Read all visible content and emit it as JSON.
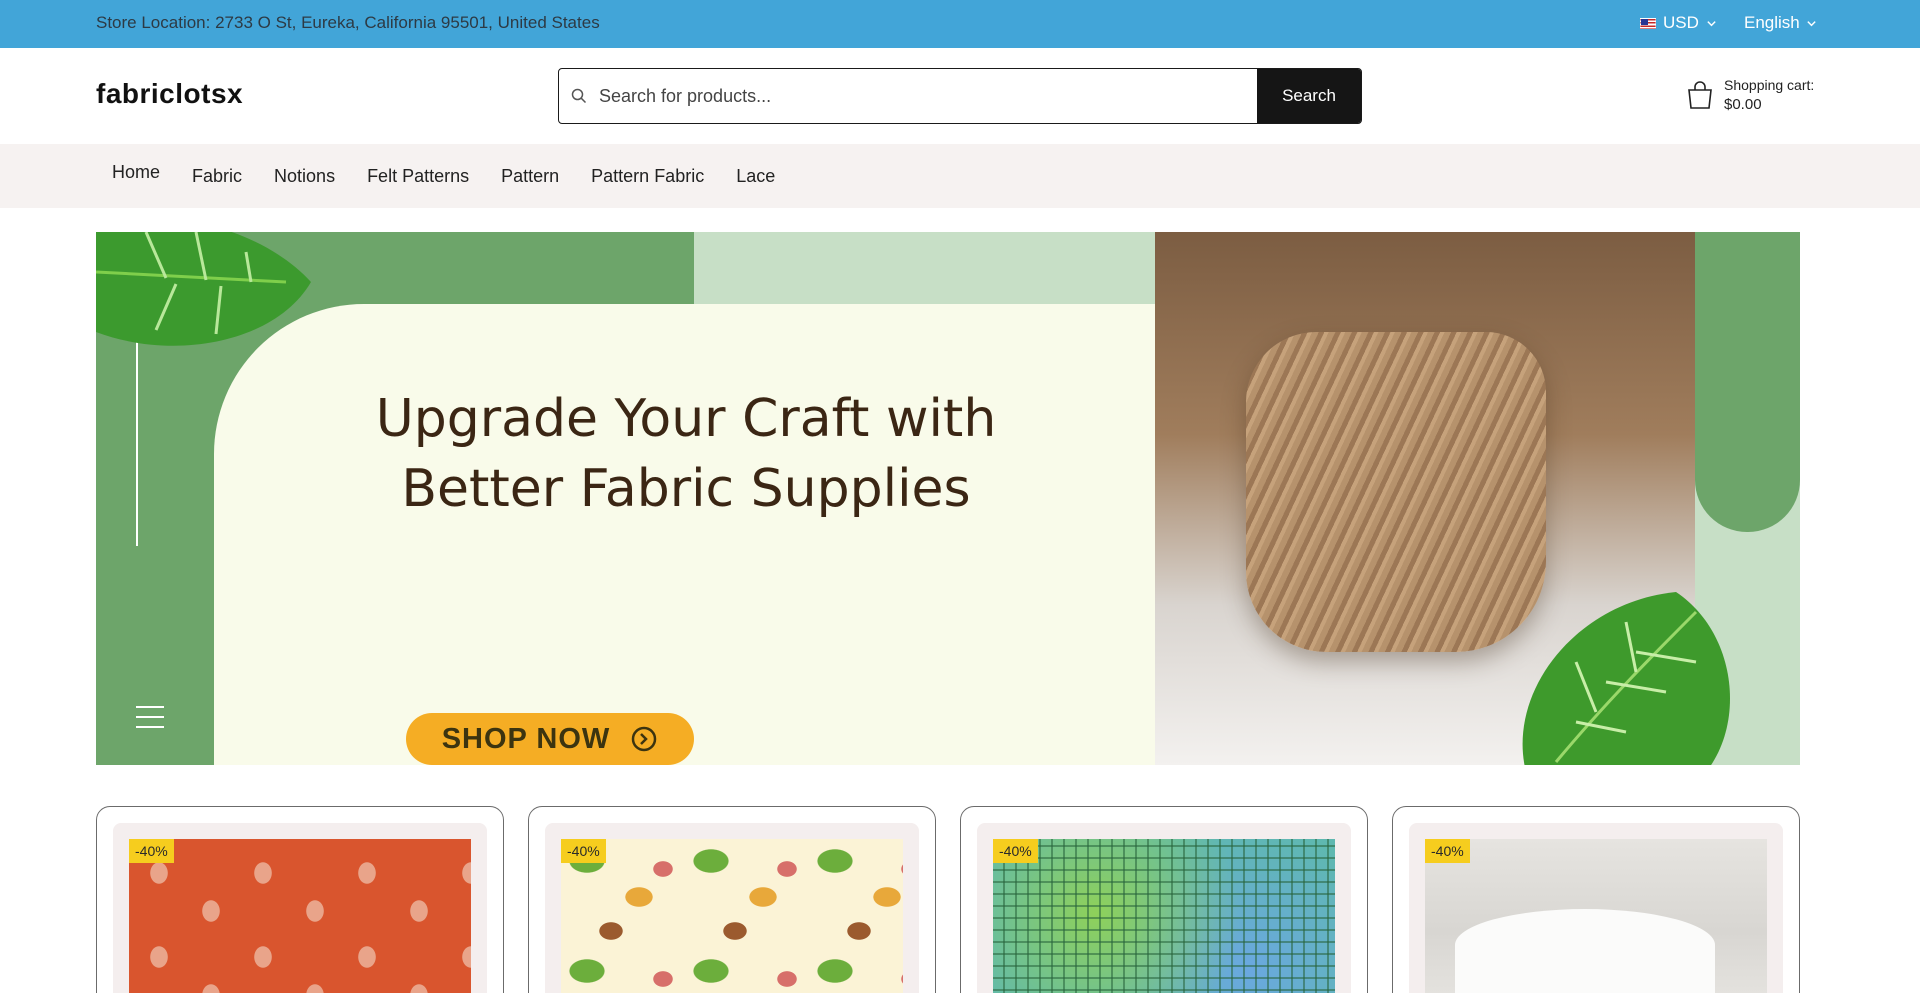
{
  "topbar": {
    "location": "Store Location: 2733 O St, Eureka, California 95501, United States",
    "currency": "USD",
    "language": "English"
  },
  "header": {
    "logo": "fabriclotsx",
    "search_placeholder": "Search for products...",
    "search_button": "Search",
    "cart_label": "Shopping cart:",
    "cart_amount": "$0.00"
  },
  "nav": {
    "items": [
      {
        "label": "Home"
      },
      {
        "label": "Fabric"
      },
      {
        "label": "Notions"
      },
      {
        "label": "Felt Patterns"
      },
      {
        "label": "Pattern"
      },
      {
        "label": "Pattern Fabric"
      },
      {
        "label": "Lace"
      }
    ]
  },
  "banner": {
    "headline_line1": "Upgrade Your Craft with",
    "headline_line2": "Better Fabric Supplies",
    "cta": "SHOP NOW"
  },
  "products": [
    {
      "badge": "-40%",
      "image": "turtle-print-fabric"
    },
    {
      "badge": "-40%",
      "image": "butterfly-insect-print-fabric"
    },
    {
      "badge": "-40%",
      "image": "batik-spiral-squares-fabric"
    },
    {
      "badge": "-40%",
      "image": "white-lace-table-runner"
    }
  ],
  "colors": {
    "topbar": "#42a5d8",
    "nav_bg": "#f6f2f1",
    "banner_green": "#6da56a",
    "banner_light_green": "#c7dfc6",
    "cta": "#f5ad24",
    "badge": "#f6cd1e",
    "search_button": "#151515"
  }
}
